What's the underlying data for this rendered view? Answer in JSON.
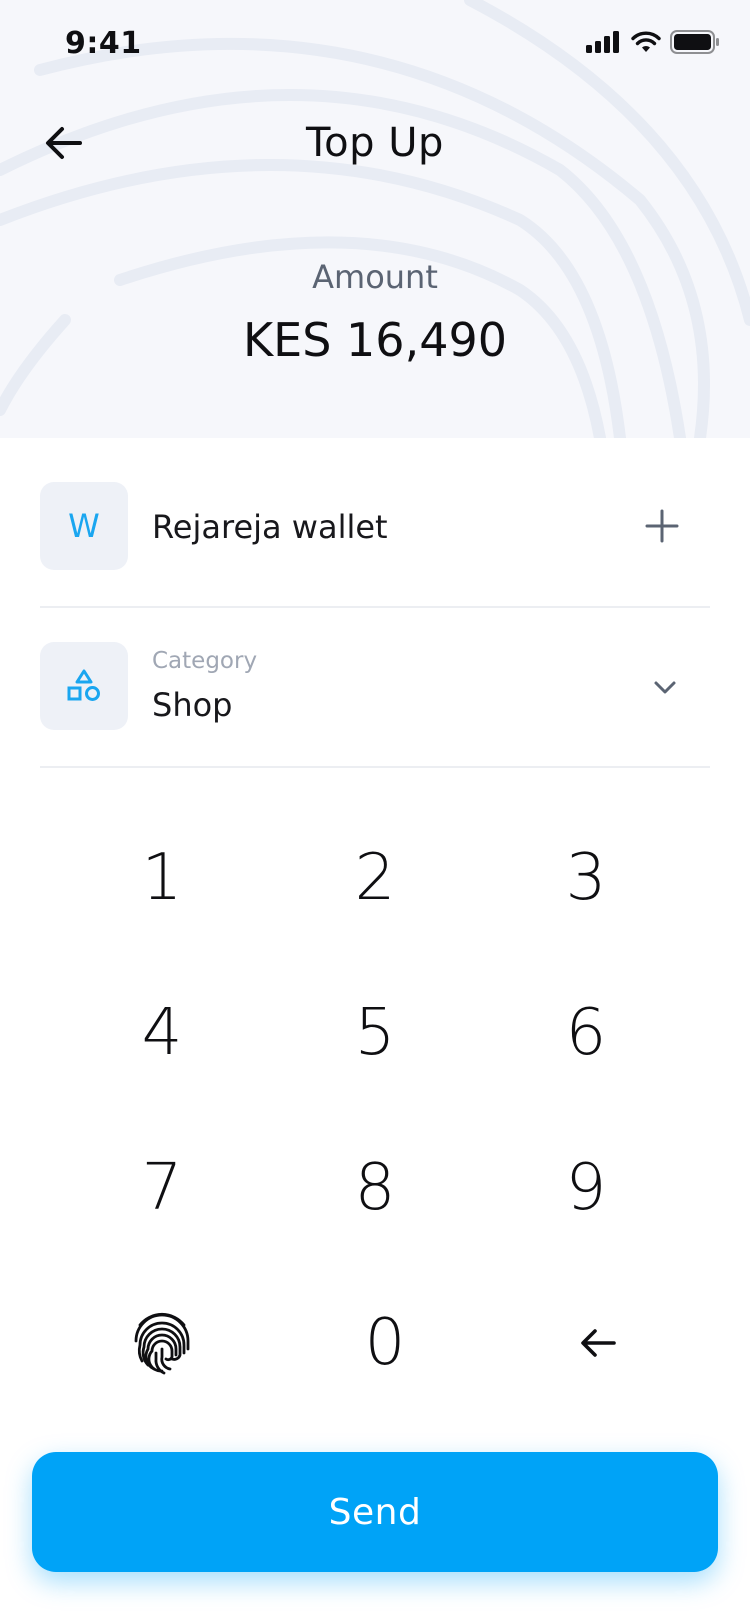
{
  "status_bar": {
    "time": "9:41"
  },
  "header": {
    "title": "Top Up",
    "amount_label": "Amount",
    "amount_value": "KES 16,490"
  },
  "wallet_row": {
    "avatar_letter": "W",
    "name": "Rejareja wallet"
  },
  "category_row": {
    "label": "Category",
    "value": "Shop"
  },
  "keypad": {
    "k1": "1",
    "k2": "2",
    "k3": "3",
    "k4": "4",
    "k5": "5",
    "k6": "6",
    "k7": "7",
    "k8": "8",
    "k9": "9",
    "k0": "0"
  },
  "send_button": {
    "label": "Send"
  },
  "colors": {
    "accent": "#00a3f7",
    "header_bg": "#f6f7fb",
    "tile_bg": "#eef1f7",
    "muted_text": "#5b6473"
  }
}
